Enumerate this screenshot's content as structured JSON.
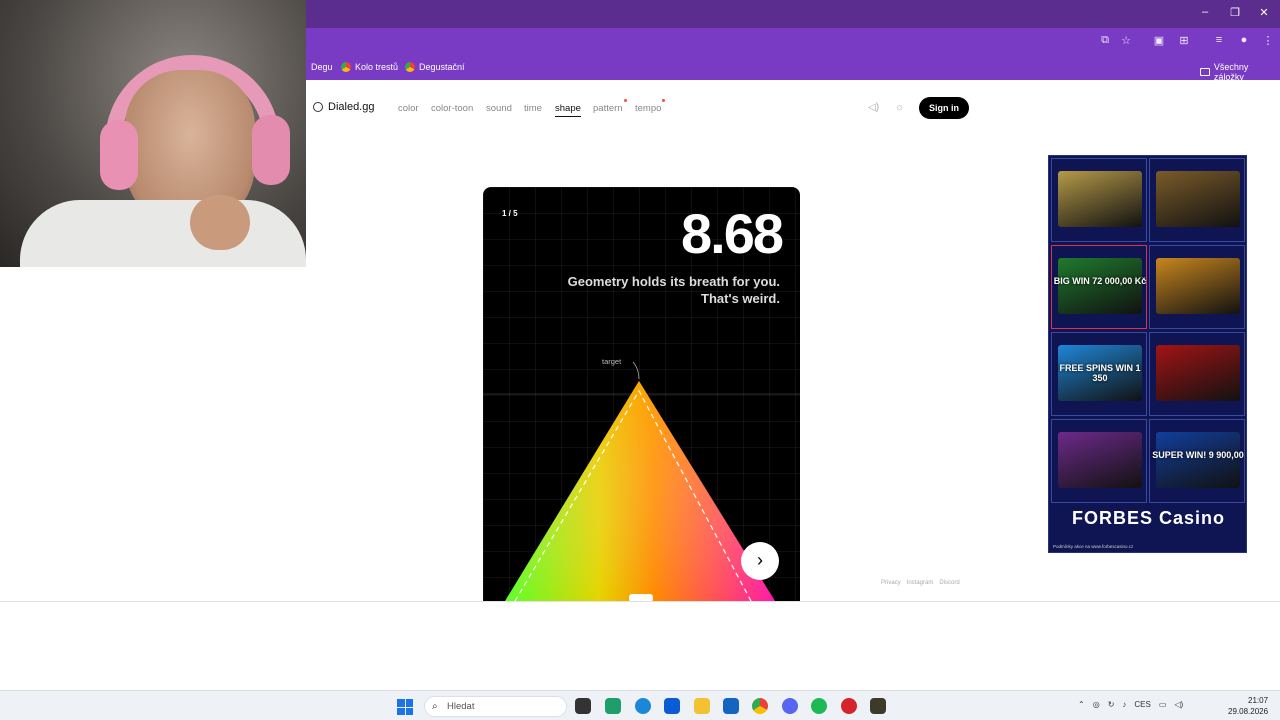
{
  "browser": {
    "bookmarks": [
      {
        "label": "Degu"
      },
      {
        "label": "Kolo trestů"
      },
      {
        "label": "Degustační"
      }
    ],
    "all_bookmarks_label": "Všechny záložky",
    "window_controls": [
      "–",
      "❐",
      "✕"
    ]
  },
  "site": {
    "logo": "Dialed.gg",
    "nav": [
      {
        "label": "color",
        "active": false
      },
      {
        "label": "color-toon",
        "active": false
      },
      {
        "label": "sound",
        "active": false
      },
      {
        "label": "time",
        "active": false
      },
      {
        "label": "shape",
        "active": true
      },
      {
        "label": "pattern",
        "active": false
      },
      {
        "label": "tempo",
        "active": false
      }
    ],
    "sign_in": "Sign in",
    "footer_links": [
      "Privacy",
      "Instagram",
      "Discord"
    ]
  },
  "game": {
    "progress": "1 / 5",
    "score": "8.68",
    "message_line1": "Geometry holds its breath for you.",
    "message_line2": "That's weird.",
    "target_label": "target",
    "next_symbol": "›"
  },
  "ad": {
    "tiles": [
      {
        "label": "",
        "color": "#b59a48"
      },
      {
        "label": "",
        "color": "#7a5b2a"
      },
      {
        "label": "BIG WIN 72 000,00 Kč",
        "color": "#1f7a2e"
      },
      {
        "label": "",
        "color": "#c8861e"
      },
      {
        "label": "FREE SPINS WIN 1 350",
        "color": "#1f86d6"
      },
      {
        "label": "",
        "color": "#a11414"
      },
      {
        "label": "",
        "color": "#6c2a8a"
      },
      {
        "label": "SUPER WIN! 9 900,00",
        "color": "#123e9c"
      }
    ],
    "brand": "FORBES Casino",
    "fine_print": "Podmínky akce na www.forbescasino.cz"
  },
  "taskbar": {
    "search_placeholder": "Hledat",
    "language": "CES",
    "time": "21:07",
    "date": "29.08.2026"
  }
}
